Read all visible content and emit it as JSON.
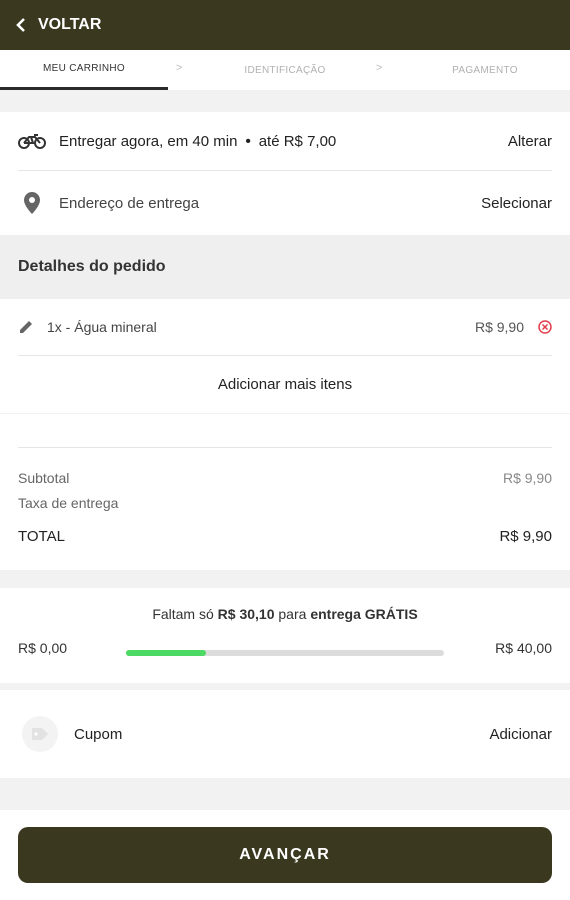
{
  "header": {
    "back_label": "VOLTAR"
  },
  "steps": [
    "MEU CARRINHO",
    "IDENTIFICAÇÃO",
    "PAGAMENTO"
  ],
  "step_separator": ">",
  "delivery": {
    "text": "Entregar agora, em 40 min",
    "dot": "•",
    "fee_text": "até R$ 7,00",
    "action": "Alterar"
  },
  "address": {
    "text": "Endereço de entrega",
    "action": "Selecionar"
  },
  "order": {
    "title": "Detalhes do pedido",
    "items": [
      {
        "label": "1x - Água mineral",
        "price": "R$ 9,90"
      }
    ],
    "add_more": "Adicionar mais itens"
  },
  "summary": {
    "subtotal_label": "Subtotal",
    "subtotal_value": "R$ 9,90",
    "fee_label": "Taxa de entrega",
    "total_label": "TOTAL",
    "total_value": "R$ 9,90"
  },
  "free_shipping": {
    "prefix": "Faltam só",
    "amount": "R$ 30,10",
    "middle": "para",
    "suffix": "entrega GRÁTIS",
    "min_label": "R$ 0,00",
    "max_label": "R$ 40,00",
    "progress": 0.25
  },
  "coupon": {
    "label": "Cupom",
    "action": "Adicionar"
  },
  "cta": {
    "label": "AVANÇAR"
  },
  "colors": {
    "primary": "#3b3820",
    "progress": "#4cd964",
    "remove": "#e0404c"
  }
}
